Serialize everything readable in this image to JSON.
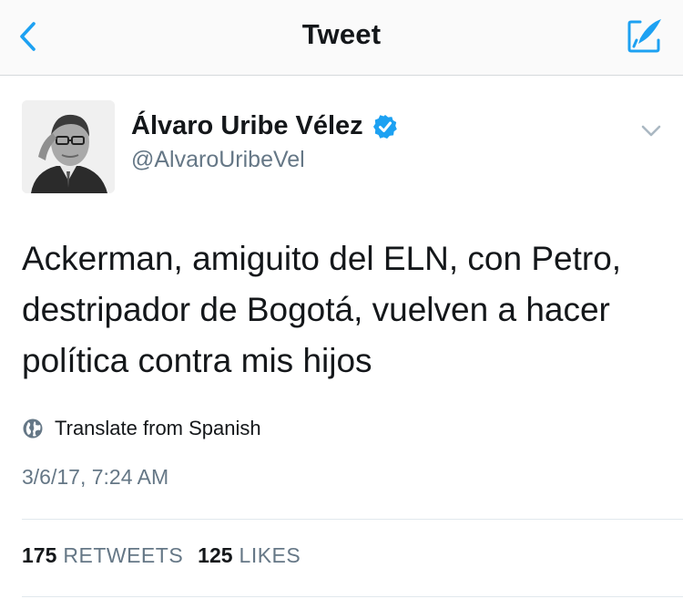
{
  "nav": {
    "title": "Tweet",
    "back_icon": "chevron-left-icon",
    "compose_icon": "compose-tweet-icon"
  },
  "tweet": {
    "author": {
      "name": "Álvaro Uribe Vélez",
      "handle": "@AlvaroUribeVel",
      "verified": true
    },
    "text": "Ackerman, amiguito del ELN, con Petro, destripador de Bogotá, vuelven a hacer política contra mis hijos",
    "translate_label": "Translate from Spanish",
    "timestamp": "3/6/17, 7:24 AM",
    "stats": {
      "retweets_count": "175",
      "retweets_label": "RETWEETS",
      "likes_count": "125",
      "likes_label": "LIKES"
    }
  },
  "colors": {
    "accent": "#1da1f2",
    "secondary_text": "#657786",
    "primary_text": "#14171a"
  }
}
